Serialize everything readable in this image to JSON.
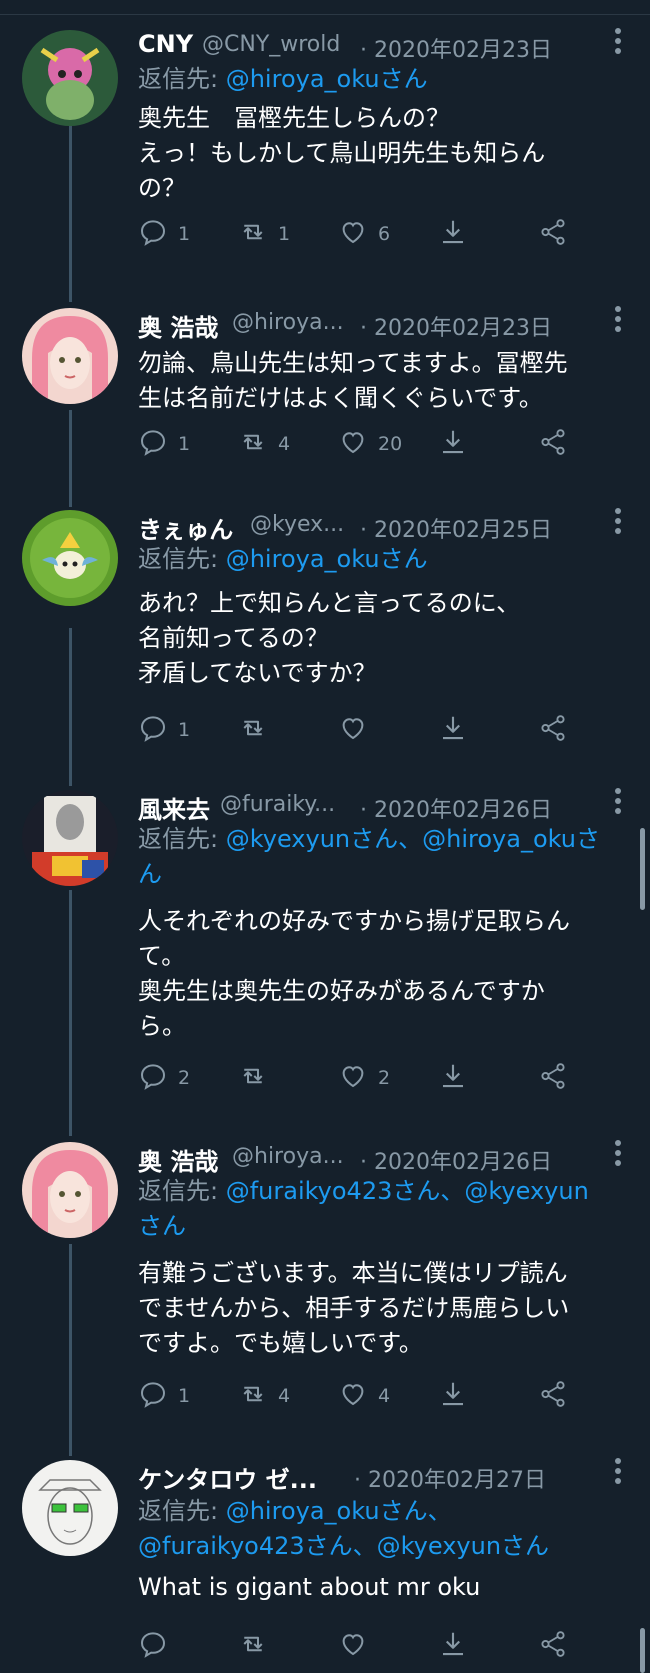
{
  "colors": {
    "background": "#15202b",
    "text": "#ffffff",
    "muted": "#8899a6",
    "link": "#1d9bf0",
    "thread_line": "#3d5466"
  },
  "reply_prefix": "返信先: ",
  "tweets": [
    {
      "name": "CNY",
      "handle": "@CNY_wrold",
      "date": "· 2020年02月23日",
      "reply_to": "@hiroya_okuさん",
      "text": "奥先生　冨樫先生しらんの？\nえっ！もしかして鳥山明先生も知らん\nの？",
      "reply_count": "1",
      "retweet_count": "1",
      "like_count": "6"
    },
    {
      "name": "奥 浩哉",
      "handle": "@hiroya...",
      "date": "· 2020年02月23日",
      "reply_to": "",
      "text": "勿論、鳥山先生は知ってますよ。冨樫先\n生は名前だけはよく聞くぐらいです。",
      "reply_count": "1",
      "retweet_count": "4",
      "like_count": "20"
    },
    {
      "name": "きぇゅん",
      "handle": "@kyex...",
      "date": "· 2020年02月25日",
      "reply_to": "@hiroya_okuさん",
      "text": "あれ？上で知らんと言ってるのに、\n名前知ってるの？\n矛盾してないですか？",
      "reply_count": "1",
      "retweet_count": "",
      "like_count": ""
    },
    {
      "name": "風来去",
      "handle": "@furaiky...",
      "date": "· 2020年02月26日",
      "reply_to": "@kyexyunさん、@hiroya_okuさ\nん",
      "text": "人それぞれの好みですから揚げ足取らん\nて。\n奥先生は奥先生の好みがあるんですか\nら。",
      "reply_count": "2",
      "retweet_count": "",
      "like_count": "2"
    },
    {
      "name": "奥 浩哉",
      "handle": "@hiroya...",
      "date": "· 2020年02月26日",
      "reply_to": "@furaikyo423さん、@kyexyun\nさん",
      "text": "有難うございます。本当に僕はリプ読ん\nでませんから、相手するだけ馬鹿らしい\nですよ。でも嬉しいです。",
      "reply_count": "1",
      "retweet_count": "4",
      "like_count": "4"
    },
    {
      "name": "ケンタロウ ゼ...",
      "handle": "",
      "date": "· 2020年02月27日",
      "reply_to": "@hiroya_okuさん、\n@furaikyo423さん、@kyexyunさん",
      "text": "What is gigant about mr oku",
      "reply_count": "",
      "retweet_count": "",
      "like_count": ""
    }
  ]
}
